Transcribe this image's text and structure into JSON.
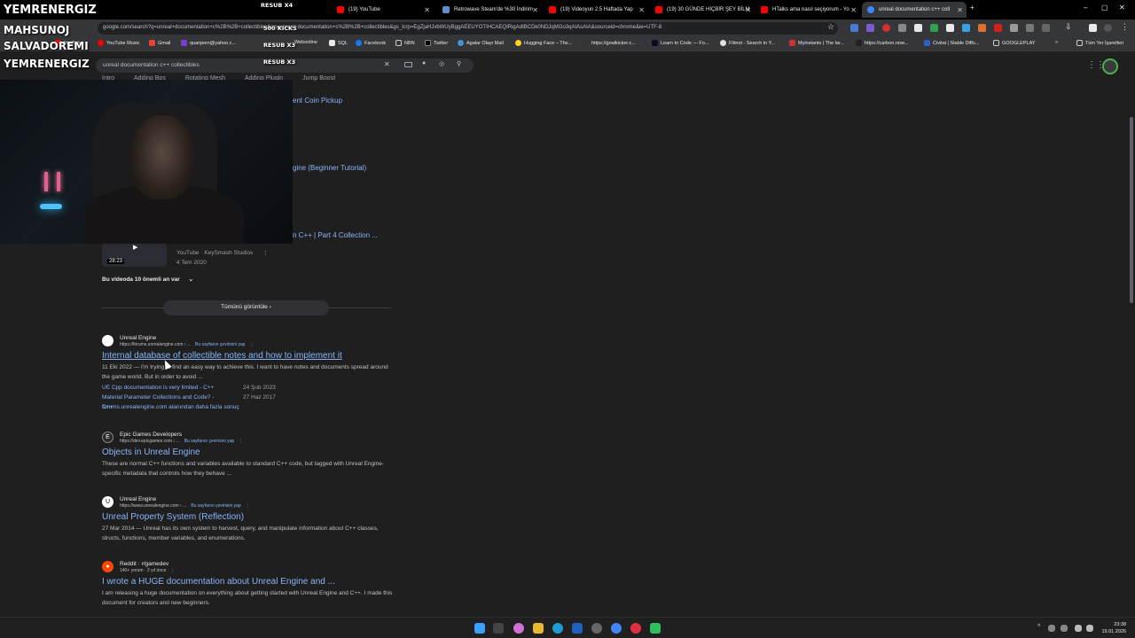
{
  "tabs": [
    {
      "label": "(19) YouTube"
    },
    {
      "label": "Retrowave Steam'de %30 İndirim"
    },
    {
      "label": "(19) Videoyun 2.5 Haftada Yap"
    },
    {
      "label": "(19) 30 GÜNDE HİÇBİR ŞEY BİLM"
    },
    {
      "label": "HTalks ama nasıl seçiyorum - Yo"
    },
    {
      "label": "unreal documentation c++ coll"
    }
  ],
  "address": "google.com/search?q=unreal+documentation+c%2B%2B+collectibles&oq=unreal+documentation+c%2B%2B+collectibles&gs_lcrp=EgZjaHJvbWUyBggAEEUYOTIHCAEQIRigAdIBCDk0NDJqMGo3qAIAsAIA&sourceid=chrome&ie=UTF-8",
  "bookmarks": [
    "YouTube",
    "YouTube Music",
    "Gmail",
    "quanjeen@yahoo.c...",
    "Webonline",
    "SQL",
    "Facebook",
    "NBN",
    "Twitter",
    "Agalar Olayı Mail",
    "Hugging Face – The...",
    "https://goalkicker.c...",
    "Learn to Code — Fo...",
    "Filmot - Search in Y...",
    "Myinstants | The lar...",
    "https://carbon.now...",
    "Civitai | Stable Diffu...",
    "GOOGLEPLAY",
    "Tüm Yer İşaretleri"
  ],
  "search_query": "unreal documentation c++ collectibles",
  "search_tabs": [
    "Intro",
    "Adding Bps",
    "Rotating Mesh",
    "Adding Plugin",
    "Jump Boost"
  ],
  "overlay": {
    "line1": "YEMRENERGIZ",
    "line2": "MAHSUNOJ",
    "line3": "SALVADOREMI",
    "line4": "YEMRENERGIZ",
    "resub1": "RESUB X4",
    "kicks": "500 KICKS",
    "resub2": "RESUB X3",
    "resub3": "RESUB X3"
  },
  "videos": {
    "partial1": "ent Coin Pickup",
    "partial2": "gine (Beginner Tutorial)",
    "partial3": "n C++ | Part 4 Collection ...",
    "duration": "28:23",
    "channel": "YouTube · KeySmash Studios",
    "date": "4 Tem 2020",
    "moments": "Bu videoda 10 önemli an var",
    "view_all": "Tümünü görüntüle"
  },
  "results": [
    {
      "source": "Unreal Engine",
      "url": "https://forums.unrealengine.com › ...",
      "translate": "Bu sayfanın çevirisini yap",
      "title": "Internal database of collectible notes and how to implement it",
      "snippet": "11 Eki 2022 — I'm trying to find an easy way to achieve this. I want to have notes and documents spread around the game world. But in order to avoid ...",
      "sub": [
        {
          "label": "UE Cpp documentation is very limited - C++",
          "date": "24 Şub 2023"
        },
        {
          "label": "Material Parameter Collections and Code? - C++",
          "date": "27 Haz 2017"
        }
      ],
      "more": "forums.unrealengine.com alanından daha fazla sonuç"
    },
    {
      "source": "Epic Games Developers",
      "url": "https://dev.epicgames.com › ...",
      "translate": "Bu sayfanın çevirisini yap",
      "title": "Objects in Unreal Engine",
      "snippet": "These are normal C++ functions and variables available to standard C++ code, but tagged with Unreal Engine-specific metadata that controls how they behave ..."
    },
    {
      "source": "Unreal Engine",
      "url": "https://www.unrealengine.com › ...",
      "translate": "Bu sayfanın çevirisini yap",
      "title": "Unreal Property System (Reflection)",
      "snippet": "27 Mar 2014 — Unreal has its own system to harvest, query, and manipulate information about C++ classes, structs, functions, member variables, and enumerations."
    },
    {
      "source": "Reddit · r/gamedev",
      "url": "140+ yorum · 2 yıl önce",
      "title": "I wrote a HUGE documentation about Unreal Engine and ...",
      "snippet": "I am releasing a huge documentation on everything about getting started with Unreal Engine and C++. I made this document for creators and new beginners."
    }
  ],
  "clock": {
    "time": "23:38",
    "date": "19.01.2026"
  }
}
